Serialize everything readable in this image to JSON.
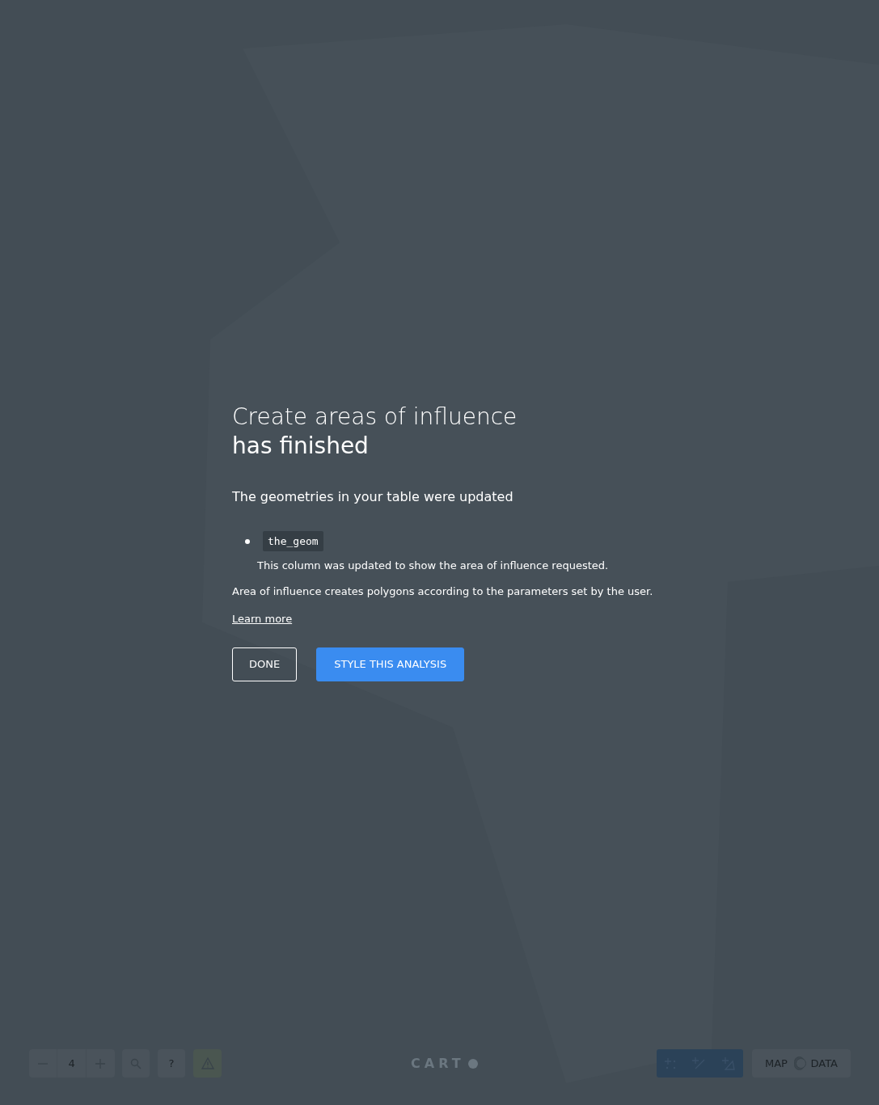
{
  "dialog": {
    "title": "Create areas of influence",
    "subtitle": "has finished",
    "message": "The geometries in your table were updated",
    "columns": [
      {
        "name": "the_geom",
        "description": "This column was updated to show the area of influence requested."
      }
    ],
    "note": "Area of influence creates polygons according to the parameters set by the user.",
    "link": "Learn more",
    "buttons": [
      {
        "label": "DONE",
        "kind": "secondary"
      },
      {
        "label": "STYLE THIS ANALYSIS",
        "kind": "primary"
      }
    ]
  },
  "map_controls": {
    "zoom_level": "4",
    "help": "?",
    "logo": "CART"
  },
  "view_toggle": {
    "left": "MAP",
    "right": "DATA",
    "on": false
  }
}
